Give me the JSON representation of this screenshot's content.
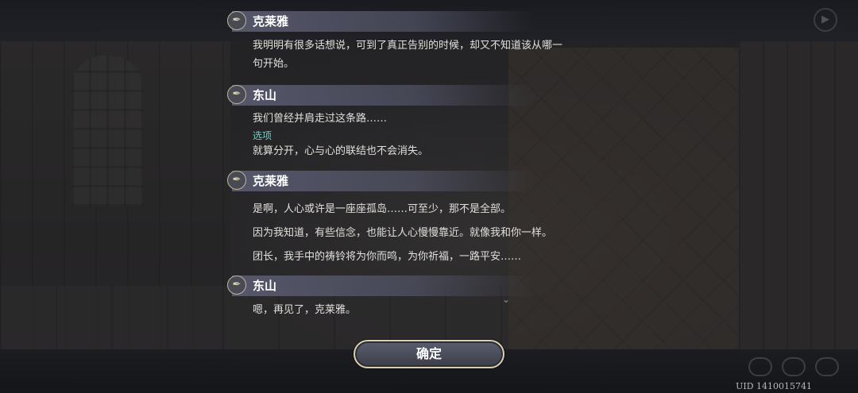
{
  "log": [
    {
      "speaker": "克莱雅",
      "lines": [
        "我明明有很多话想说，可到了真正告别的时候，却又不知道该从哪一",
        "句开始。"
      ]
    },
    {
      "speaker": "东山",
      "lines": [
        "我们曾经并肩走过这条路……"
      ],
      "option_label": "选项",
      "option_text": "就算分开，心与心的联结也不会消失。"
    },
    {
      "speaker": "克莱雅",
      "lines": [
        "是啊，人心或许是一座座孤岛……可至少，那不是全部。",
        "因为我知道，有些信念，也能让人心慢慢靠近。就像我和你一样。",
        "团长，我手中的祷铃将为你而鸣，为你祈福，一路平安……"
      ]
    },
    {
      "speaker": "东山",
      "lines": [
        "嗯，再见了，克莱雅。"
      ]
    }
  ],
  "confirm_label": "确定",
  "uid": "UID 1410015741",
  "icons": {
    "speaker": "quill-icon",
    "top_right": "circle-button-icon",
    "arrow": "chevron-down-icon"
  }
}
